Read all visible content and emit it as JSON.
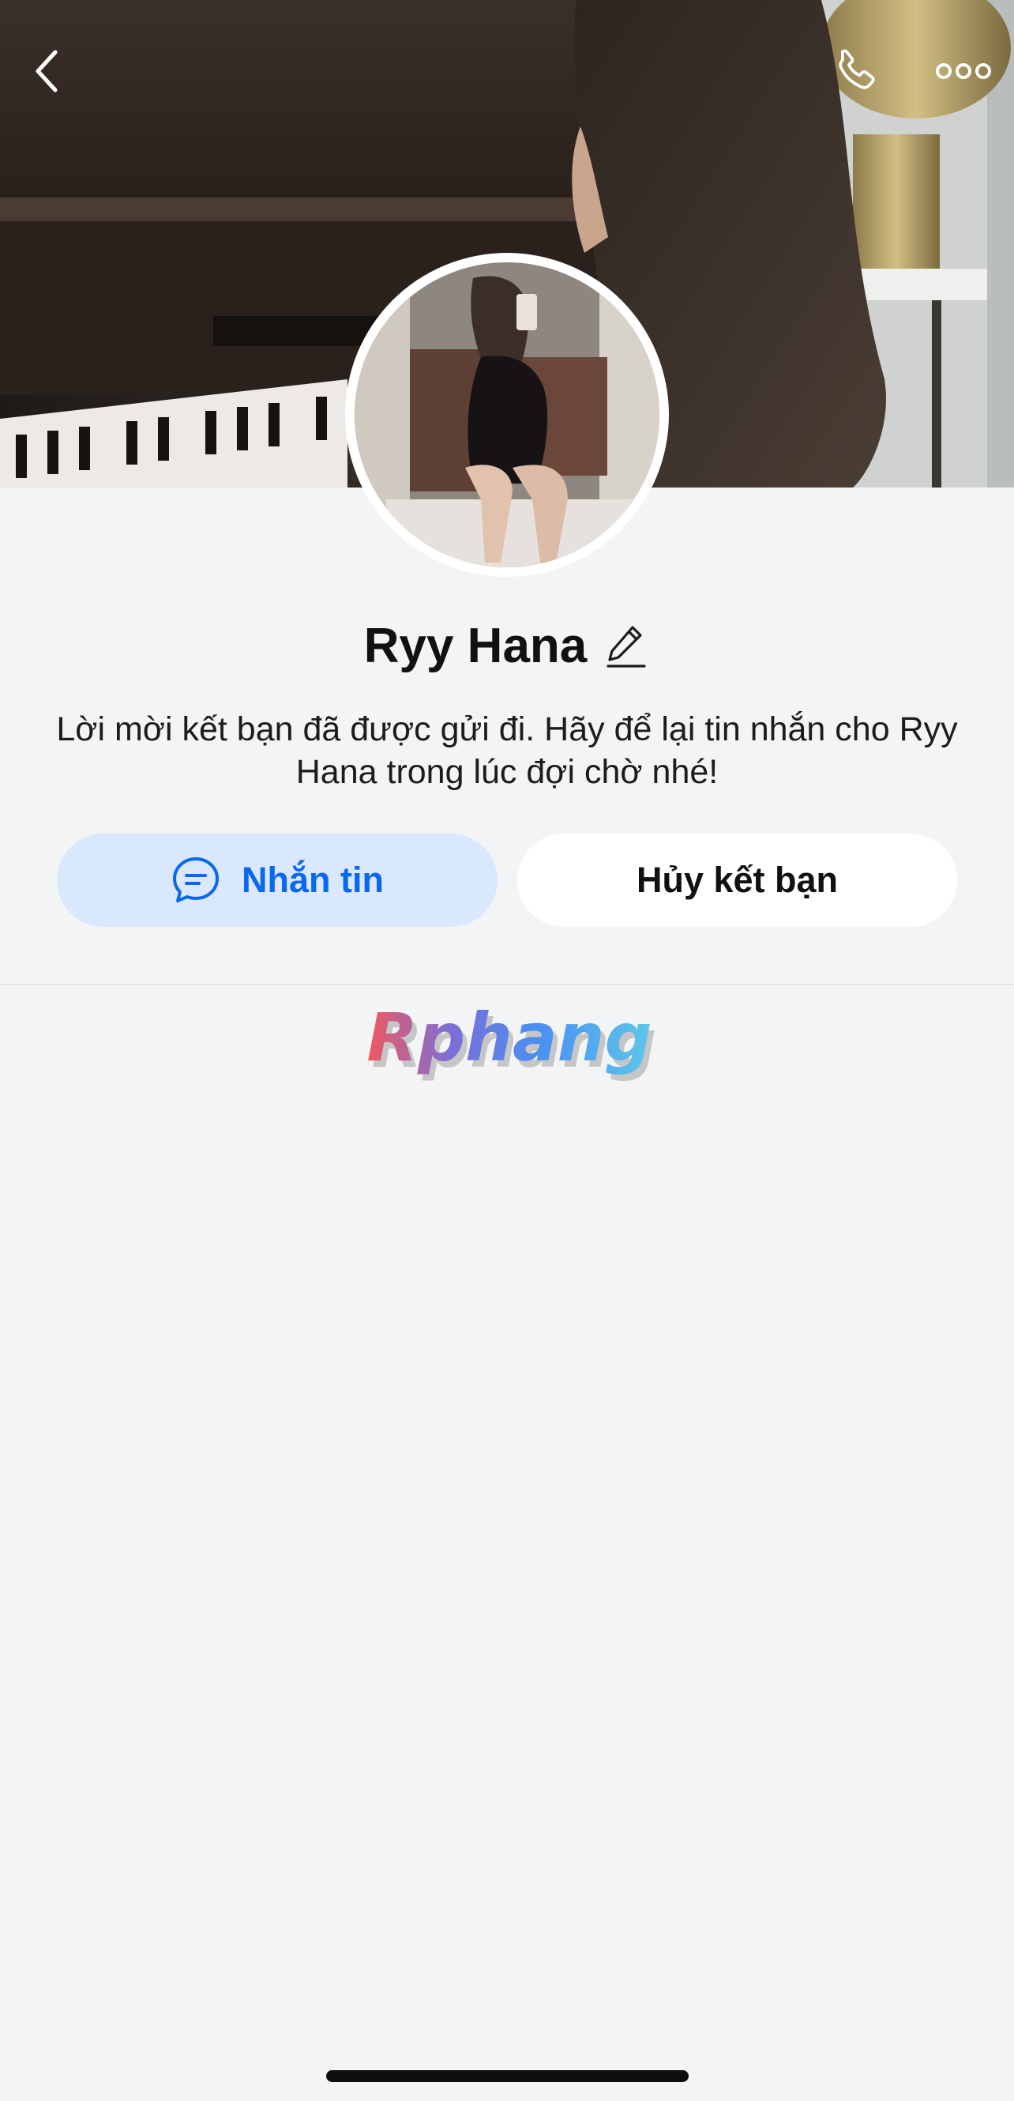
{
  "header": {
    "back_icon": "chevron-left-icon",
    "call_icon": "phone-icon",
    "more_icon": "more-horizontal-icon"
  },
  "profile": {
    "name": "Ryy Hana",
    "edit_icon": "pencil-icon",
    "status_message": "Lời mời kết bạn đã được gửi đi. Hãy để lại tin nhắn cho Ryy Hana trong lúc đợi chờ nhé!"
  },
  "actions": {
    "message_label": "Nhắn tin",
    "message_icon": "chat-bubble-icon",
    "unfriend_label": "Hủy kết bạn"
  },
  "watermark": {
    "text": "Rphang"
  },
  "colors": {
    "accent": "#0a68f0",
    "message_button_bg": "#d9e8fd",
    "page_bg": "#f3f4f6"
  }
}
